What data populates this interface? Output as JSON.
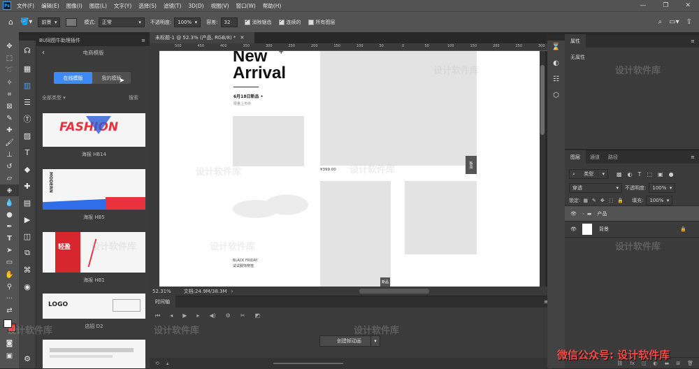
{
  "app": {
    "logo": "Ps"
  },
  "menu": [
    "文件(F)",
    "编辑(E)",
    "图像(I)",
    "图层(L)",
    "文字(Y)",
    "选择(S)",
    "滤镜(T)",
    "3D(D)",
    "视图(V)",
    "窗口(W)",
    "帮助(H)"
  ],
  "window_controls": {
    "minimize": "—",
    "restore": "❐",
    "close": "✕"
  },
  "options": {
    "preset": "前景",
    "mode_label": "模式:",
    "mode_value": "正常",
    "opacity_label": "不透明度:",
    "opacity_value": "100%",
    "tolerance_label": "容差:",
    "tolerance_value": "32",
    "antialias": "消除锯齿",
    "contiguous": "连续的",
    "all_layers": "所有图层"
  },
  "plugin": {
    "tab": "BU同图牛助理插件",
    "title": "电商模版",
    "btn_online": "在线模版",
    "btn_mine": "我的模版",
    "filter": "全部类型 ▾",
    "search": "搜索",
    "cards": [
      {
        "name": "海报 HB14",
        "art": "FASHION"
      },
      {
        "name": "海报 HB5",
        "art": "MODERN"
      },
      {
        "name": "海报 HB1",
        "art": "轻盈"
      },
      {
        "name": "店招 D2",
        "art": "LOGO"
      },
      {
        "name": "",
        "art": ""
      }
    ]
  },
  "document": {
    "tab": "未标题-1 @ 52.3% (产品, RGB/8) *",
    "ruler_ticks": [
      "500",
      "450",
      "400",
      "350",
      "300",
      "250",
      "200",
      "150",
      "100",
      "50",
      "0",
      "50",
      "100",
      "150",
      "200",
      "250",
      "300"
    ],
    "headline1": "New",
    "headline2": "Arrival",
    "date": "6月18日新品 •",
    "sub": "限量上市中",
    "price": "¥399.00",
    "side_tag1": "新品",
    "side_tag2": "新品",
    "bottom_text1": "BLACK FRIDAY",
    "bottom_text2": "试试服饰穿搭"
  },
  "status": {
    "zoom": "52.31%",
    "doc": "文档:24.9M/38.3M"
  },
  "timeline": {
    "title": "时间轴",
    "create_btn": "创建帧动画"
  },
  "properties": {
    "title": "属性",
    "body": "无属性"
  },
  "layers_panel": {
    "tabs": [
      "图层",
      "通道",
      "路径"
    ],
    "kind": "类型",
    "blend": "穿透",
    "opacity_label": "不透明度:",
    "opacity": "100%",
    "lock_label": "锁定:",
    "fill_label": "填充:",
    "fill": "100%",
    "layers": [
      {
        "name": "产品",
        "type": "group"
      },
      {
        "name": "背景",
        "type": "pixel"
      }
    ]
  },
  "watermarks": [
    "设计软件库",
    "微信公众号: 设计软件库"
  ]
}
